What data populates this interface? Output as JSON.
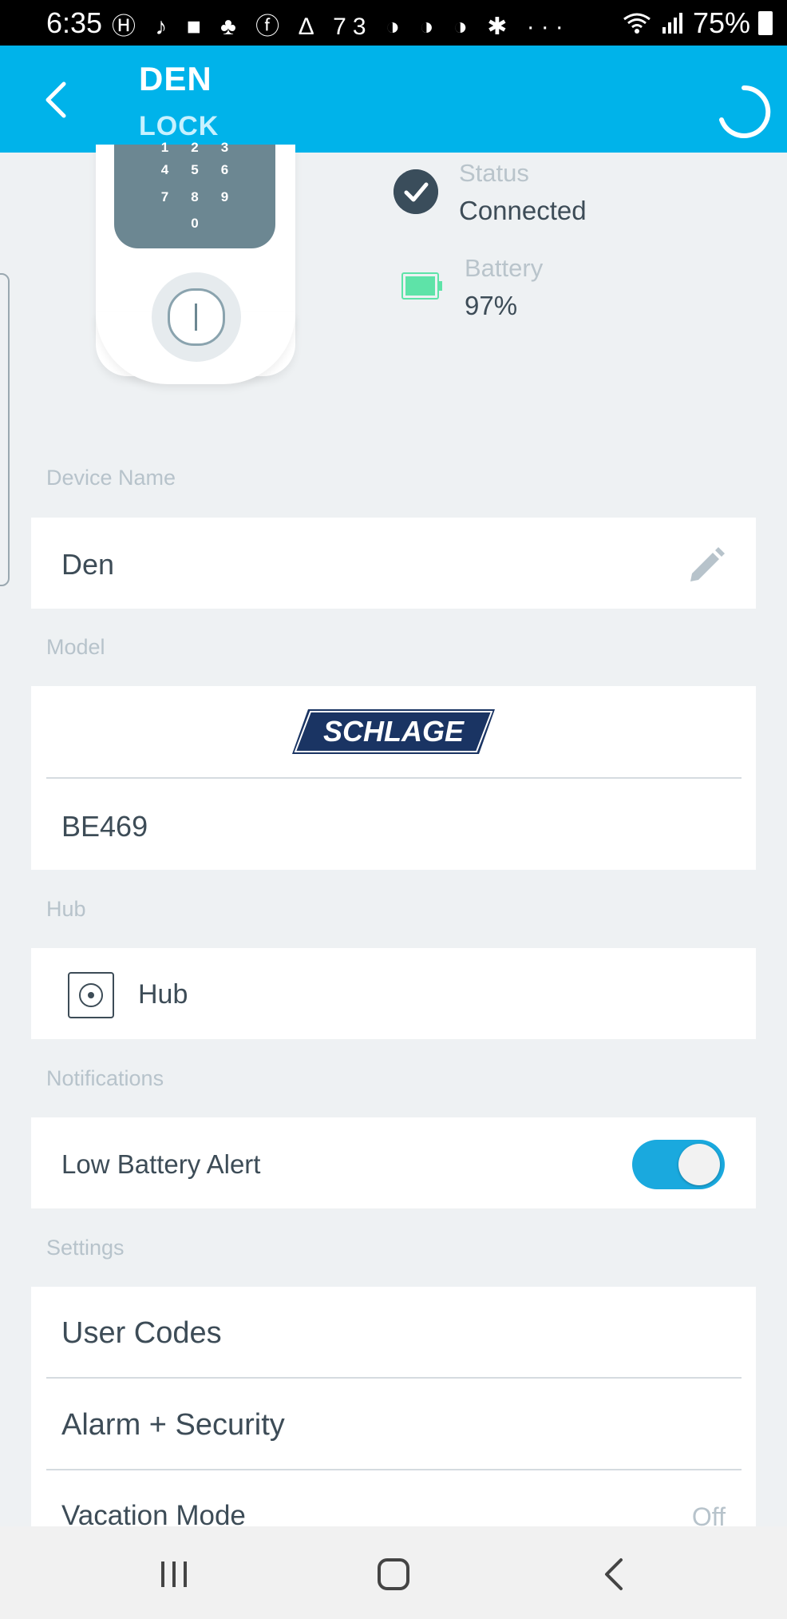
{
  "status_bar": {
    "time": "6:35",
    "notification_icons": "Ⓗ ♪ ■ ♣ ⓕ ∆ 73 ◑ ◑ ◑ ✱ ···",
    "battery_percent": "75%"
  },
  "header": {
    "title": "DEN",
    "subtitle": "LOCK"
  },
  "keypad": {
    "row1": [
      "1",
      "2",
      "3"
    ],
    "row2": [
      "4",
      "5",
      "6"
    ],
    "row3": [
      "7",
      "8",
      "9"
    ],
    "row4": [
      "0"
    ]
  },
  "device_status": {
    "status_label": "Status",
    "status_value": "Connected",
    "battery_label": "Battery",
    "battery_value": "97%"
  },
  "device_name": {
    "section_label": "Device Name",
    "value": "Den"
  },
  "model": {
    "section_label": "Model",
    "brand_logo_text": "SCHLAGE",
    "value": "BE469"
  },
  "hub": {
    "section_label": "Hub",
    "value": "Hub"
  },
  "notifications": {
    "section_label": "Notifications",
    "low_battery_label": "Low Battery Alert",
    "low_battery_enabled": true
  },
  "settings": {
    "section_label": "Settings",
    "items": [
      {
        "label": "User Codes",
        "value": ""
      },
      {
        "label": "Alarm + Security",
        "value": ""
      },
      {
        "label": "Vacation Mode",
        "value": "Off"
      }
    ]
  },
  "colors": {
    "header_bg": "#00b3ea",
    "toggle_on": "#1aa9de",
    "battery_green": "#5ee3a8",
    "status_check_bg": "#3a4d5b"
  },
  "icons": [
    "back-arrow-icon",
    "loading-spinner-icon",
    "check-icon",
    "battery-icon",
    "pencil-icon",
    "hub-icon",
    "recents-icon",
    "home-icon",
    "nav-back-icon"
  ]
}
